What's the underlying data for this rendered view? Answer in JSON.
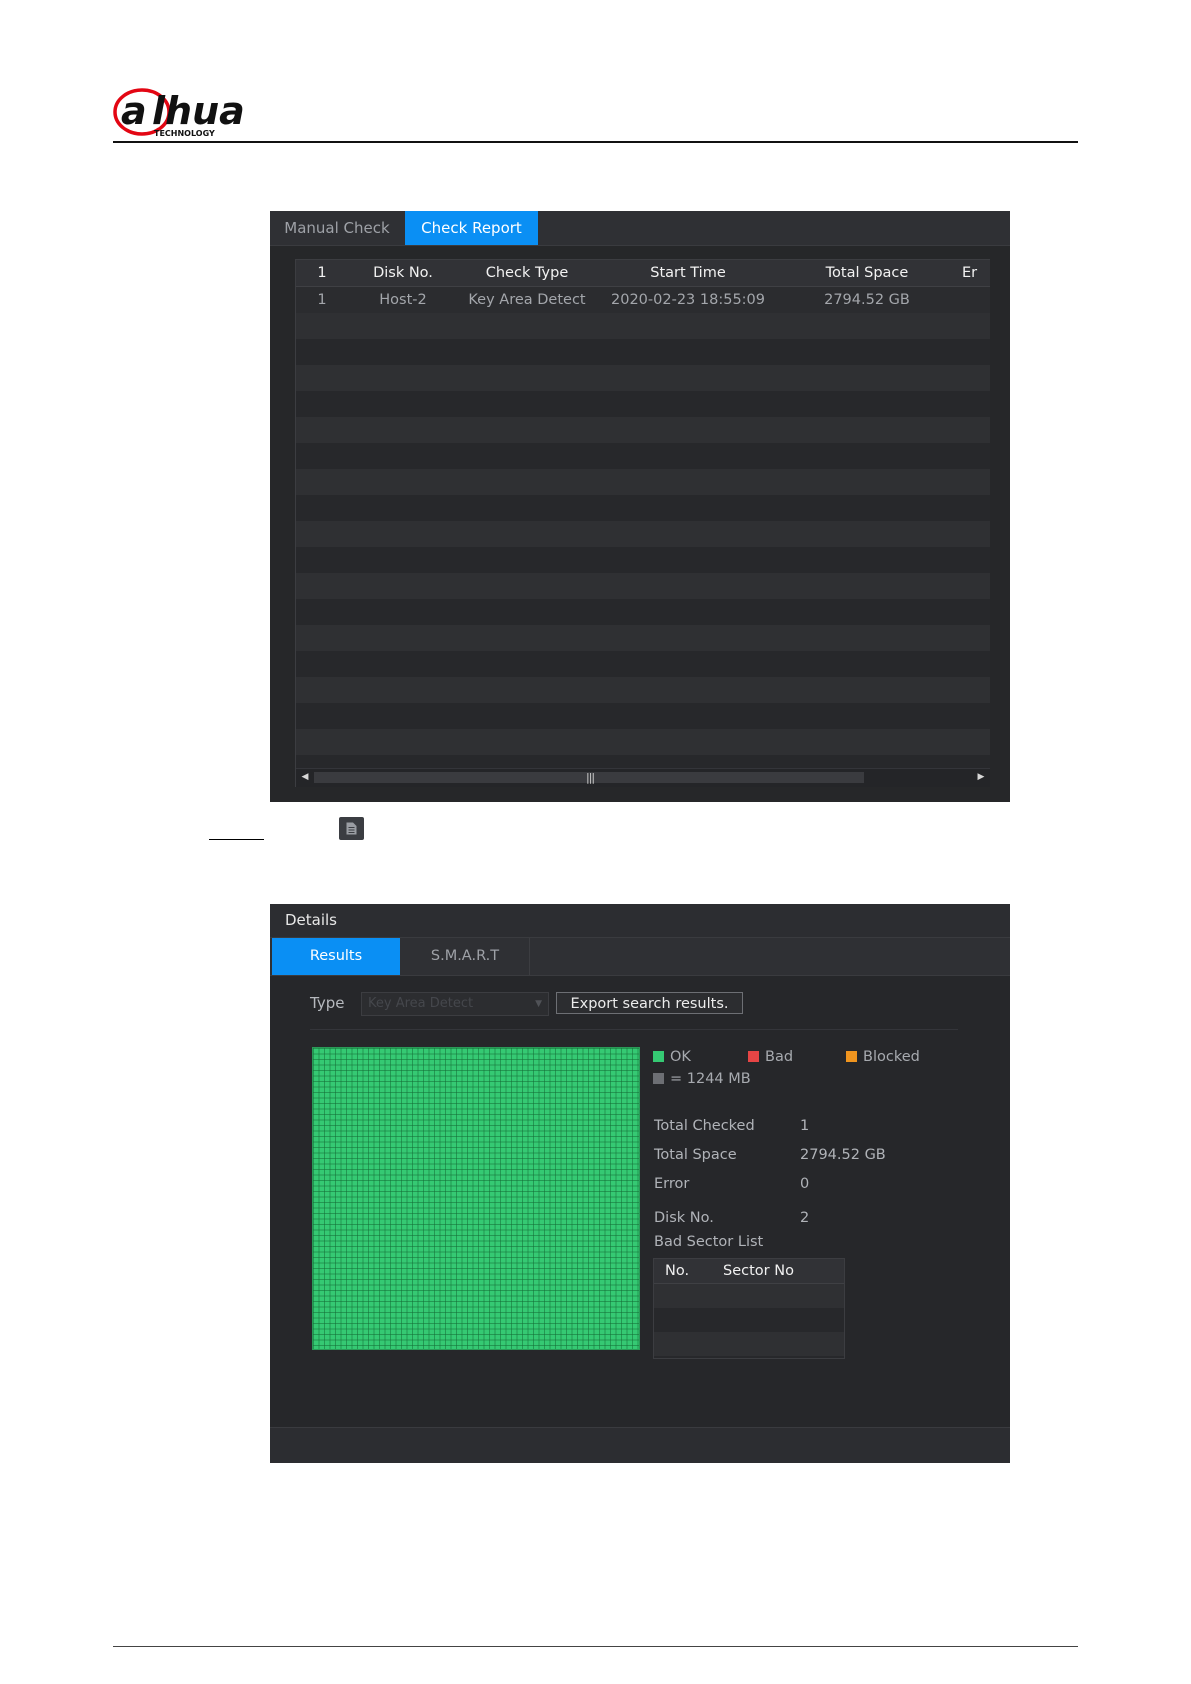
{
  "brand": {
    "logo_alt": "alhua",
    "logo_sub": "TECHNOLOGY",
    "colors": {
      "red": "#e30613",
      "black": "#111111"
    }
  },
  "check_report": {
    "tabs": [
      {
        "label": "Manual Check",
        "active": false
      },
      {
        "label": "Check Report",
        "active": true
      }
    ],
    "columns": [
      "1",
      "Disk No.",
      "Check Type",
      "Start Time",
      "Total Space",
      "Er"
    ],
    "rows": [
      [
        "1",
        "Host-2",
        "Key Area Detect",
        "2020-02-23 18:55:09",
        "2794.52 GB",
        ""
      ]
    ],
    "scroll_grip": "|||",
    "accent": "#0a8ff4"
  },
  "details_icon": "document-icon",
  "details": {
    "title": "Details",
    "tabs": [
      {
        "label": "Results",
        "active": true
      },
      {
        "label": "S.M.A.R.T",
        "active": false
      }
    ],
    "type_label": "Type",
    "type_value": "Key Area Detect",
    "export_label": "Export search results.",
    "legend": {
      "ok": "OK",
      "bad": "Bad",
      "blocked": "Blocked",
      "unit": "= 1244 MB",
      "colors": {
        "ok": "#35c973",
        "bad": "#e64545",
        "blocked": "#f0951f",
        "unit": "#6d6f74"
      }
    },
    "info": {
      "total_checked_label": "Total Checked",
      "total_checked_value": "1",
      "total_space_label": "Total Space",
      "total_space_value": "2794.52 GB",
      "error_label": "Error",
      "error_value": "0",
      "disk_no_label": "Disk No.",
      "disk_no_value": "2",
      "bad_sector_label": "Bad Sector List"
    },
    "bad_sector_columns": [
      "No.",
      "Sector No"
    ]
  }
}
